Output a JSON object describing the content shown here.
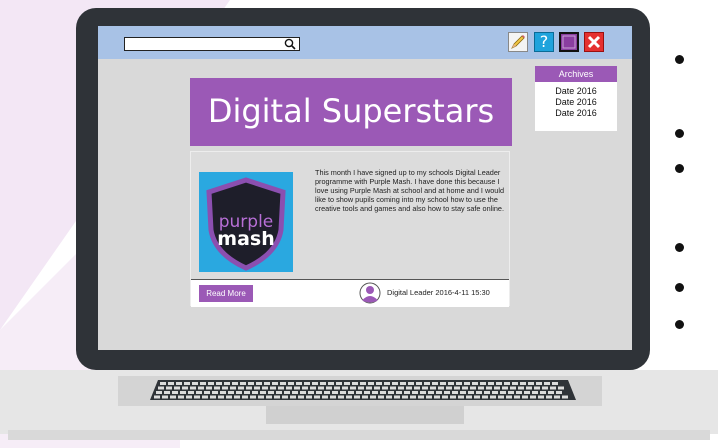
{
  "search": {
    "value": "",
    "placeholder": ""
  },
  "toolbar": {
    "pencil_icon": "pencil-icon",
    "help_label": "?",
    "book_icon": "book-icon",
    "close_icon": "close-icon"
  },
  "main": {
    "title": "Digital Superstars",
    "archives": {
      "header": "Archives",
      "items": [
        "Date 2016",
        "Date 2016",
        "Date 2016"
      ]
    },
    "post": {
      "logo_word1": "purple",
      "logo_word2": "mash",
      "text": "This month I have signed up to my schools Digital Leader programme with Purple Mash. I have done this because I love using Purple Mash at school and at home and I would like to show pupils coming into my school how to use the creative tools and games and also how to stay safe online.",
      "read_more": "Read More",
      "author_line": "Digital Leader 2016-4-11 15:30"
    }
  },
  "colors": {
    "accent": "#9b59b6",
    "topbar": "#a8c2e6",
    "screen": "#d9d9d9",
    "laptop": "#2f3338",
    "logo_bg": "#2aa8e0"
  }
}
